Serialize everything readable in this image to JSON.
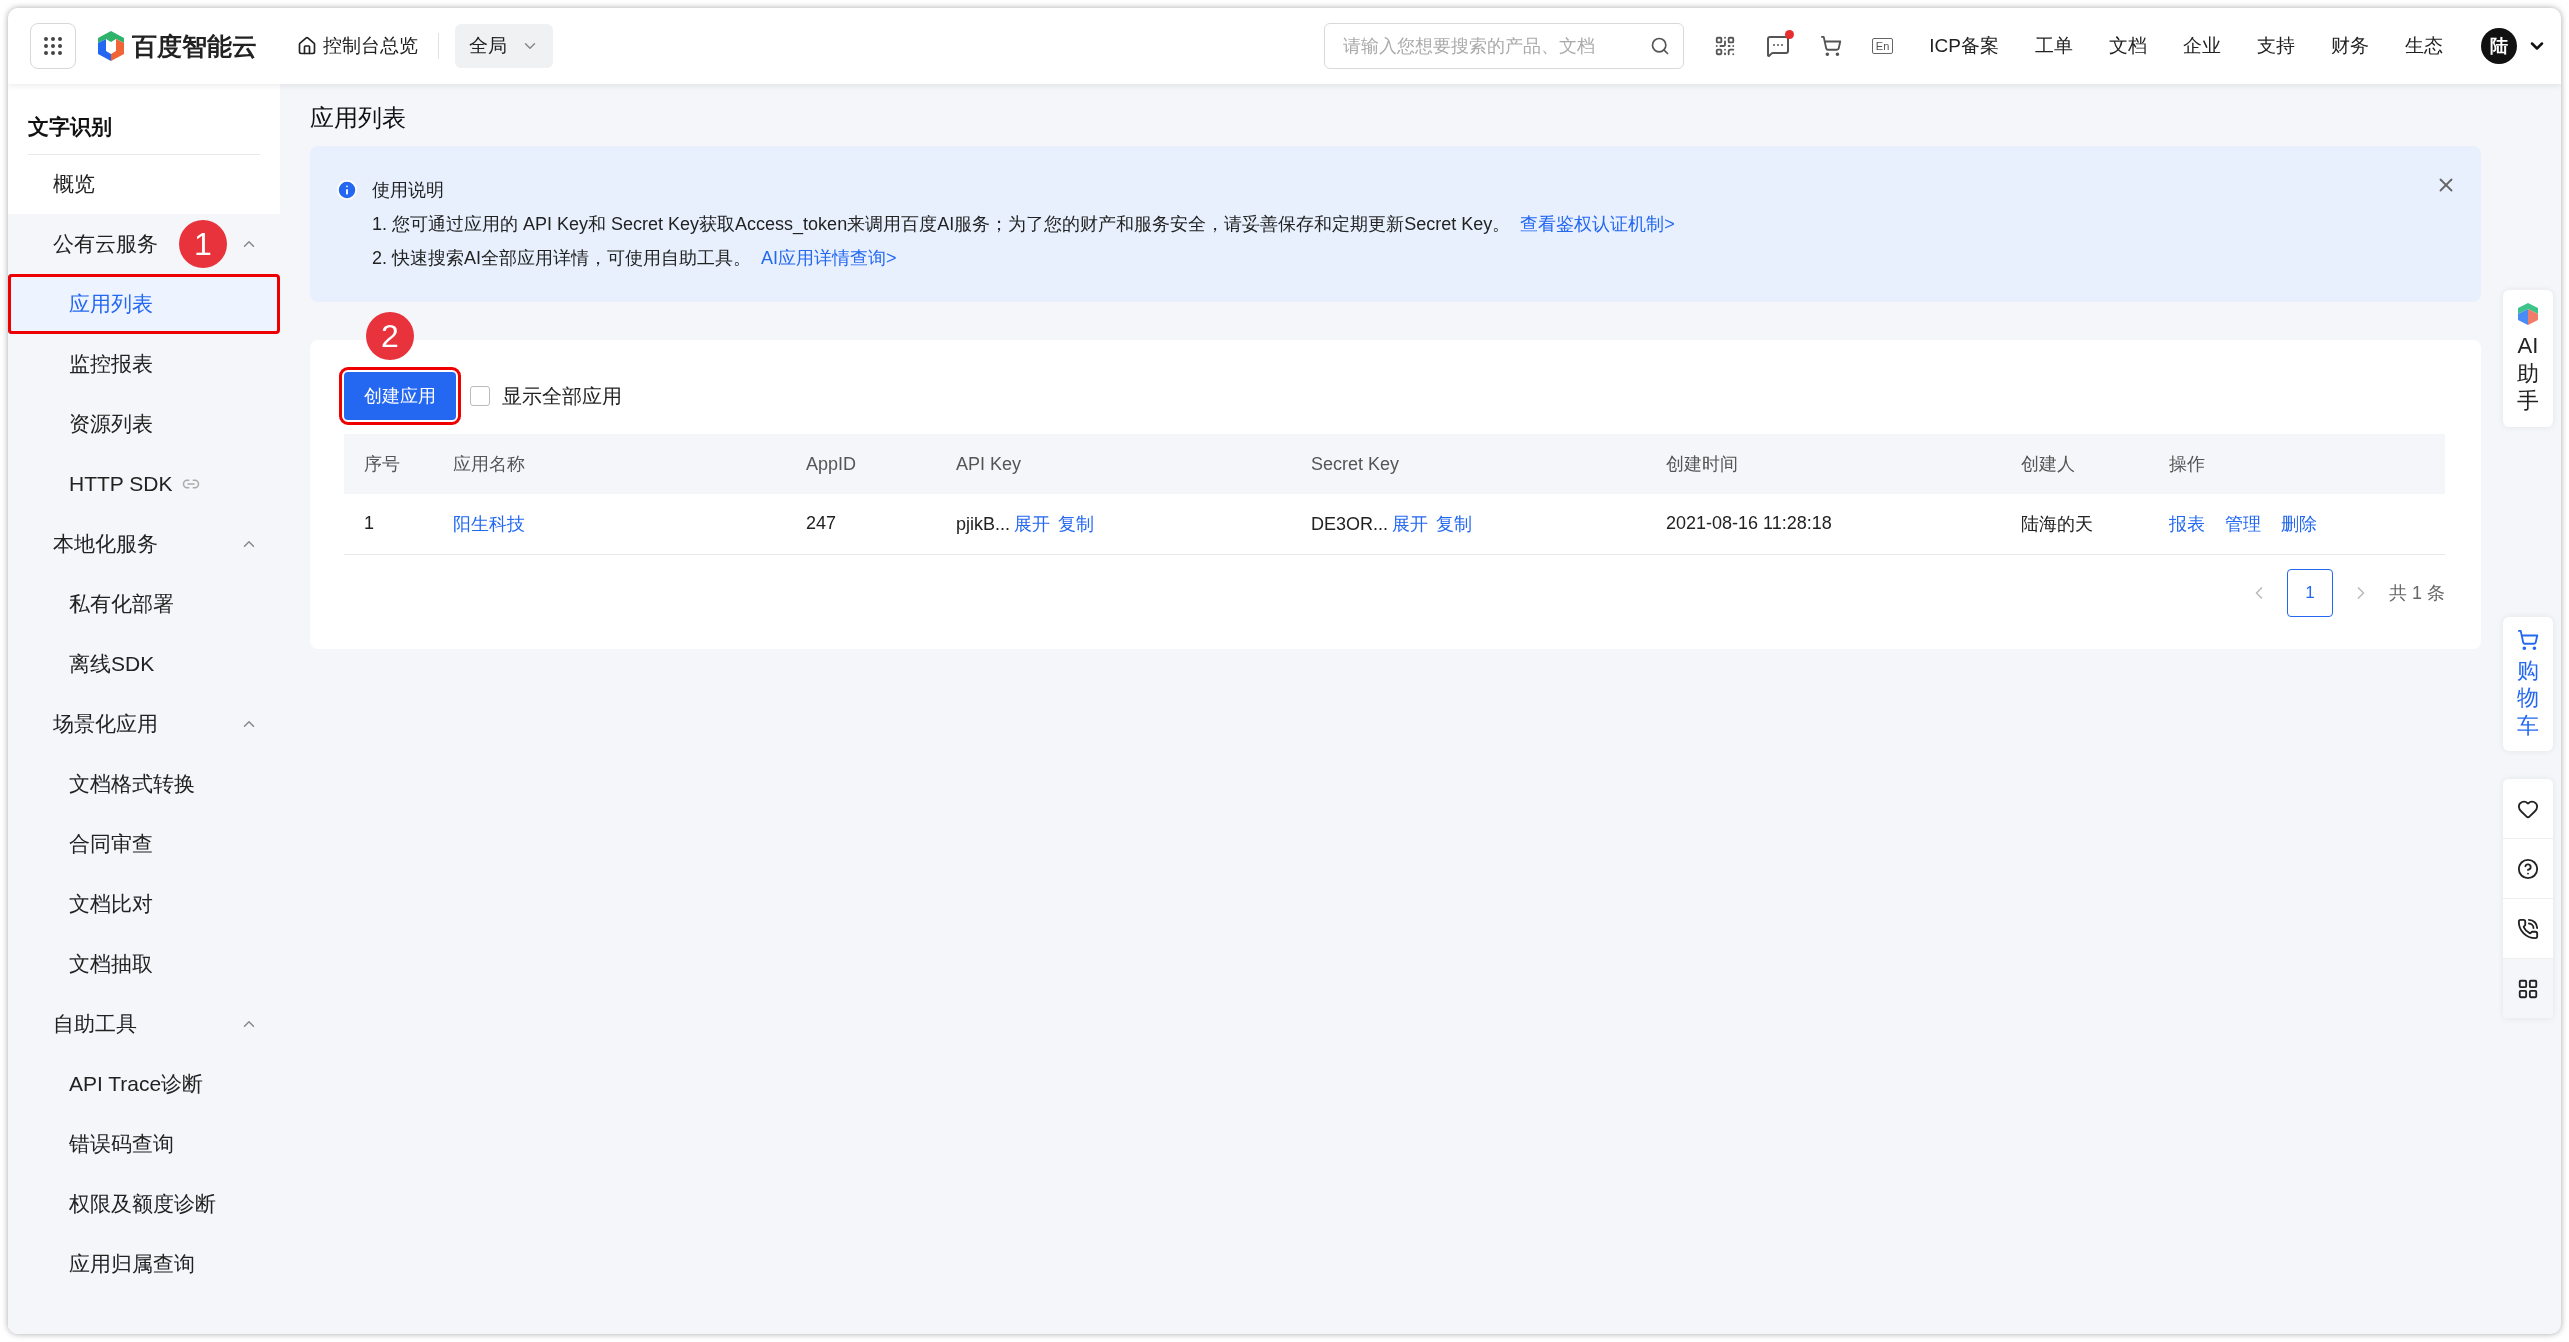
{
  "topbar": {
    "logo": "百度智能云",
    "home_link": "控制台总览",
    "scope_select": "全局",
    "search": {
      "placeholder": "请输入您想要搜索的产品、文档"
    },
    "message_unread": true,
    "language_toggle": "En",
    "nav_links": [
      "ICP备案",
      "工单",
      "文档",
      "企业",
      "支持",
      "财务",
      "生态"
    ],
    "avatar": "陆"
  },
  "sidebar": {
    "title": "文字识别",
    "items": [
      {
        "label": "概览",
        "kind": "link",
        "selected": false
      },
      {
        "label": "公有云服务",
        "kind": "group",
        "expanded": true,
        "marker": "1",
        "children": [
          {
            "label": "应用列表",
            "selected": true,
            "highlighted": true
          },
          {
            "label": "监控报表",
            "selected": false
          },
          {
            "label": "资源列表",
            "selected": false
          },
          {
            "label": "HTTP SDK",
            "selected": false,
            "external": true
          }
        ]
      },
      {
        "label": "本地化服务",
        "kind": "group",
        "expanded": true,
        "children": [
          {
            "label": "私有化部署",
            "selected": false
          },
          {
            "label": "离线SDK",
            "selected": false
          }
        ]
      },
      {
        "label": "场景化应用",
        "kind": "group",
        "expanded": true,
        "children": [
          {
            "label": "文档格式转换",
            "selected": false
          },
          {
            "label": "合同审查",
            "selected": false
          },
          {
            "label": "文档比对",
            "selected": false
          },
          {
            "label": "文档抽取",
            "selected": false
          }
        ]
      },
      {
        "label": "自助工具",
        "kind": "group",
        "expanded": true,
        "children": [
          {
            "label": "API Trace诊断",
            "selected": false
          },
          {
            "label": "错误码查询",
            "selected": false
          },
          {
            "label": "权限及额度诊断",
            "selected": false
          },
          {
            "label": "应用归属查询",
            "selected": false
          }
        ]
      }
    ]
  },
  "page_title": "应用列表",
  "notice": {
    "title": "使用说明",
    "lines": [
      {
        "text": "1. 您可通过应用的 API Key和 Secret Key获取Access_token来调用百度AI服务；为了您的财产和服务安全，请妥善保存和定期更新Secret Key。",
        "link": "查看鉴权认证机制>"
      },
      {
        "text": "2. 快速搜索AI全部应用详情，可使用自助工具。",
        "link": "AI应用详情查询>"
      }
    ]
  },
  "toolbar": {
    "create_button": {
      "label": "创建应用",
      "marker": "2",
      "highlighted": true
    },
    "show_all": {
      "label": "显示全部应用",
      "checked": false
    }
  },
  "table": {
    "columns": [
      "序号",
      "应用名称",
      "AppID",
      "API Key",
      "Secret Key",
      "创建时间",
      "创建人",
      "操作"
    ],
    "rows": [
      {
        "index": "1",
        "name": "阳生科技",
        "app_id": "247",
        "api_key": {
          "text": "pjikB...",
          "actions": [
            "展开",
            "复制"
          ]
        },
        "secret_key": {
          "text": "DE3OR...",
          "actions": [
            "展开",
            "复制"
          ]
        },
        "created": "2021-08-16 11:28:18",
        "creator": "陆海的天",
        "actions": [
          "报表",
          "管理",
          "删除"
        ]
      }
    ]
  },
  "pagination": {
    "pages": [
      {
        "label": "1",
        "selected": true
      }
    ],
    "total": "共 1 条"
  },
  "dock": {
    "assistant": "AI助手",
    "cart": "购物车"
  }
}
